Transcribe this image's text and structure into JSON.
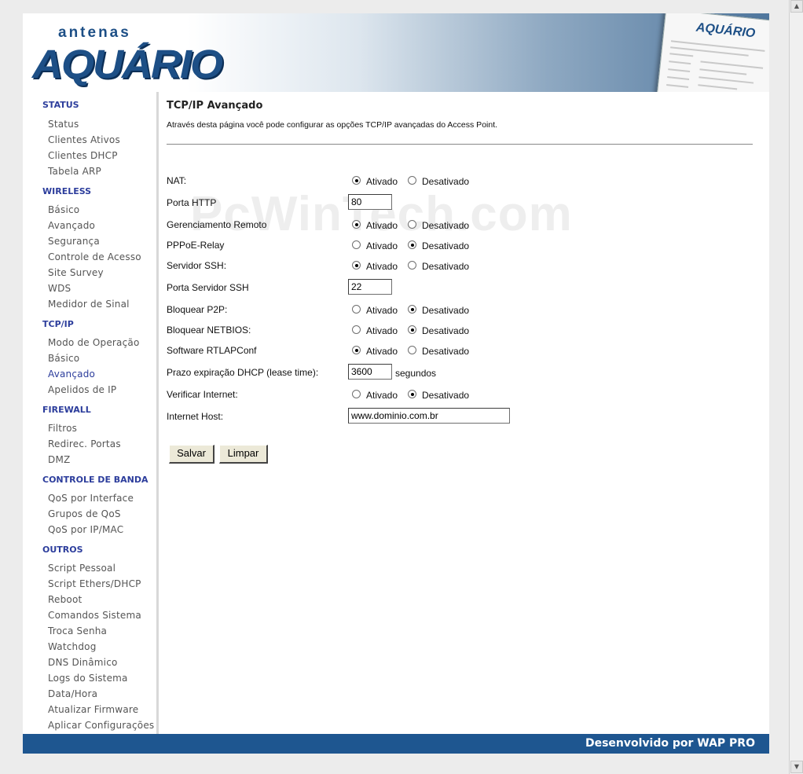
{
  "header": {
    "logo_small": "antenas",
    "logo_big": "AQUÁRIO",
    "preview_logo": "AQUÁRIO"
  },
  "sidebar": {
    "sections": [
      {
        "title": "STATUS",
        "items": [
          "Status",
          "Clientes Ativos",
          "Clientes DHCP",
          "Tabela ARP"
        ]
      },
      {
        "title": "WIRELESS",
        "items": [
          "Básico",
          "Avançado",
          "Segurança",
          "Controle de Acesso",
          "Site Survey",
          "WDS",
          "Medidor de Sinal"
        ]
      },
      {
        "title": "TCP/IP",
        "items": [
          "Modo de Operação",
          "Básico",
          "Avançado",
          "Apelidos de IP"
        ]
      },
      {
        "title": "FIREWALL",
        "items": [
          "Filtros",
          "Redirec. Portas",
          "DMZ"
        ]
      },
      {
        "title": "CONTROLE DE BANDA",
        "items": [
          "QoS por Interface",
          "Grupos de QoS",
          "QoS por IP/MAC"
        ]
      },
      {
        "title": "OUTROS",
        "items": [
          "Script Pessoal",
          "Script Ethers/DHCP",
          "Reboot",
          "Comandos Sistema",
          "Troca Senha",
          "Watchdog",
          "DNS Dinâmico",
          "Logs do Sistema",
          "Data/Hora",
          "Atualizar Firmware",
          "Aplicar Configurações"
        ]
      }
    ],
    "active_item": "TCP/IP > Avançado"
  },
  "main": {
    "title": "TCP/IP Avançado",
    "description": "Através desta página você pode configurar as opções TCP/IP avançadas do Access Point.",
    "watermark": "PcWinTech.com",
    "options": {
      "on": "Ativado",
      "off": "Desativado"
    },
    "fields": {
      "nat": {
        "label": "NAT:",
        "value": "Ativado"
      },
      "porta_http": {
        "label": "Porta HTTP",
        "value": "80"
      },
      "gerenciamento_remoto": {
        "label": "Gerenciamento Remoto",
        "value": "Ativado"
      },
      "pppoe_relay": {
        "label": "PPPoE-Relay",
        "value": "Desativado"
      },
      "servidor_ssh": {
        "label": "Servidor SSH:",
        "value": "Ativado"
      },
      "porta_ssh": {
        "label": "Porta Servidor SSH",
        "value": "22"
      },
      "bloquear_p2p": {
        "label": "Bloquear P2P:",
        "value": "Desativado"
      },
      "bloquear_netbios": {
        "label": "Bloquear NETBIOS:",
        "value": "Desativado"
      },
      "rtlapconf": {
        "label": "Software RTLAPConf",
        "value": "Ativado"
      },
      "dhcp_lease": {
        "label": "Prazo expiração DHCP (lease time):",
        "value": "3600",
        "unit": "segundos"
      },
      "verificar_internet": {
        "label": "Verificar Internet:",
        "value": "Desativado"
      },
      "internet_host": {
        "label": "Internet Host:",
        "value": "www.dominio.com.br"
      }
    },
    "buttons": {
      "save": "Salvar",
      "clear": "Limpar"
    }
  },
  "footer": {
    "text": "Desenvolvido por WAP PRO"
  },
  "colors": {
    "accent": "#2c3d9c",
    "footer": "#1e5690",
    "logo": "#1d4f86"
  }
}
